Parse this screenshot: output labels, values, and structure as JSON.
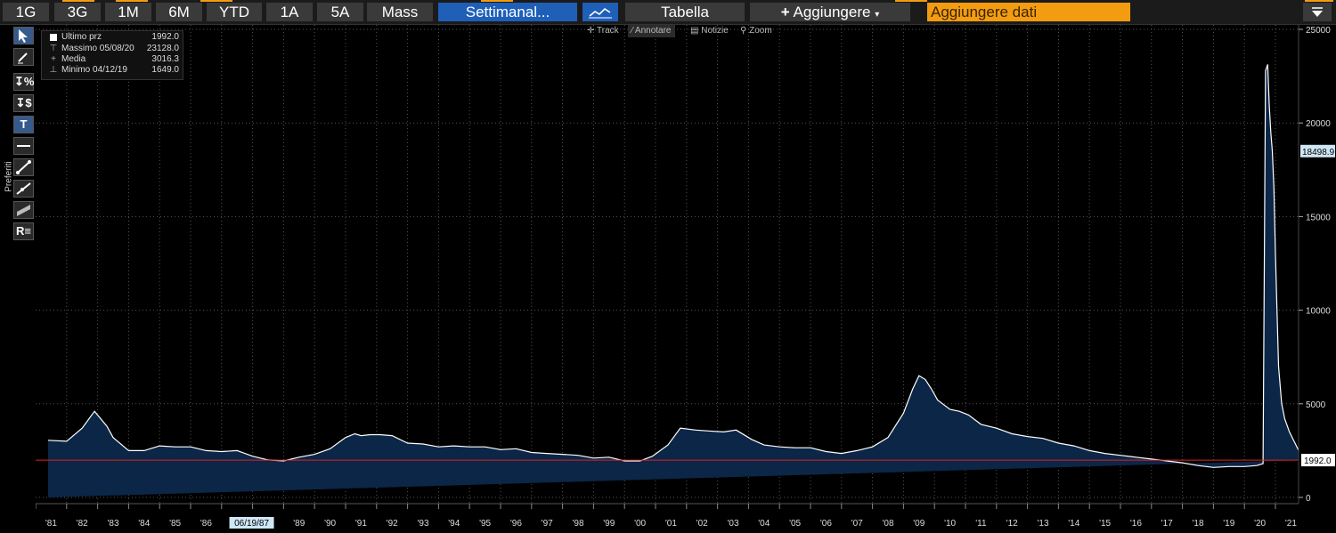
{
  "toolbar": {
    "periods": [
      "1G",
      "3G",
      "1M",
      "6M",
      "YTD",
      "1A",
      "5A",
      "Mass"
    ],
    "frequency_label": "Settimanal...",
    "table_label": "Tabella",
    "add_label": "Aggiungere",
    "add_data_label": "Aggiungere dati"
  },
  "side_toolbar": {
    "favorites_label": "Preferiti"
  },
  "legend": {
    "items": [
      {
        "label": "Ultimo prz",
        "value": "1992.0"
      },
      {
        "label": "Massimo 05/08/20",
        "value": "23128.0"
      },
      {
        "label": "Media",
        "value": "3016.3"
      },
      {
        "label": "Minimo 04/12/19",
        "value": "1649.0"
      }
    ]
  },
  "chart_tools": [
    "Track",
    "Annotare",
    "Notizie",
    "Zoom"
  ],
  "colors": {
    "area_fill": "#0b2647",
    "line": "#ffffff",
    "last_line": "#e02020",
    "active_button": "#1f5fb8",
    "add_data": "#f39c12"
  },
  "chart_data": {
    "type": "area",
    "frequency": "weekly",
    "xlabel": "",
    "ylabel": "",
    "ylim": [
      0,
      25000
    ],
    "yticks": [
      0,
      5000,
      10000,
      15000,
      20000,
      25000
    ],
    "xticks": [
      "'81",
      "'82",
      "'83",
      "'84",
      "'85",
      "'86",
      "'87",
      "'88",
      "'89",
      "'90",
      "'91",
      "'92",
      "'93",
      "'94",
      "'95",
      "'96",
      "'97",
      "'98",
      "'99",
      "'00",
      "'01",
      "'02",
      "'03",
      "'04",
      "'05",
      "'06",
      "'07",
      "'08",
      "'09",
      "'10",
      "'11",
      "'12",
      "'13",
      "'14",
      "'15",
      "'16",
      "'17",
      "'18",
      "'19",
      "'20",
      "'21"
    ],
    "cursor_label": "06/19/87",
    "last_value_label": "1992.0",
    "level_label": "18498.9",
    "grid": true,
    "x": [
      1980.9,
      1981.5,
      1982.0,
      1982.4,
      1982.8,
      1983.0,
      1983.5,
      1984.0,
      1984.5,
      1985.0,
      1985.5,
      1986.0,
      1986.5,
      1987.0,
      1987.5,
      1988.0,
      1988.5,
      1989.0,
      1989.5,
      1990.0,
      1990.5,
      1990.8,
      1991.0,
      1991.3,
      1991.6,
      1992.0,
      1992.5,
      1993.0,
      1993.5,
      1994.0,
      1994.5,
      1995.0,
      1995.5,
      1996.0,
      1996.5,
      1997.0,
      1997.5,
      1998.0,
      1998.5,
      1999.0,
      1999.5,
      2000.0,
      2000.4,
      2000.9,
      2001.3,
      2001.8,
      2002.2,
      2002.7,
      2003.1,
      2003.6,
      2004.0,
      2004.5,
      2005.0,
      2005.5,
      2006.0,
      2006.5,
      2007.0,
      2007.5,
      2008.0,
      2008.5,
      2008.8,
      2009.0,
      2009.2,
      2009.4,
      2009.6,
      2010.0,
      2010.3,
      2010.6,
      2011.0,
      2011.5,
      2012.0,
      2012.5,
      2013.0,
      2013.5,
      2014.0,
      2014.5,
      2015.0,
      2015.5,
      2016.0,
      2016.5,
      2017.0,
      2017.5,
      2018.0,
      2018.5,
      2019.0,
      2019.5,
      2019.9,
      2020.1,
      2020.18,
      2020.25,
      2020.3,
      2020.35,
      2020.4,
      2020.45,
      2020.5,
      2020.6,
      2020.7,
      2020.8,
      2020.95,
      2021.1,
      2021.25,
      2021.35,
      2021.45
    ],
    "values": [
      3050,
      3000,
      3700,
      4600,
      3800,
      3200,
      2500,
      2500,
      2750,
      2700,
      2700,
      2500,
      2450,
      2500,
      2200,
      2000,
      1950,
      2150,
      2300,
      2600,
      3200,
      3400,
      3300,
      3350,
      3350,
      3300,
      2900,
      2850,
      2700,
      2750,
      2700,
      2700,
      2550,
      2600,
      2400,
      2350,
      2300,
      2250,
      2100,
      2150,
      1950,
      1950,
      2200,
      2800,
      3700,
      3600,
      3550,
      3500,
      3600,
      3100,
      2800,
      2700,
      2650,
      2650,
      2450,
      2350,
      2500,
      2700,
      3200,
      4500,
      5800,
      6500,
      6300,
      5800,
      5200,
      4700,
      4600,
      4400,
      3900,
      3700,
      3400,
      3250,
      3150,
      2900,
      2750,
      2500,
      2350,
      2250,
      2150,
      2050,
      1950,
      1850,
      1700,
      1600,
      1650,
      1649,
      1700,
      1800,
      22800,
      23128,
      21000,
      19500,
      18498.9,
      16500,
      13000,
      7000,
      5000,
      4200,
      3500,
      3000,
      2500,
      1992
    ]
  }
}
